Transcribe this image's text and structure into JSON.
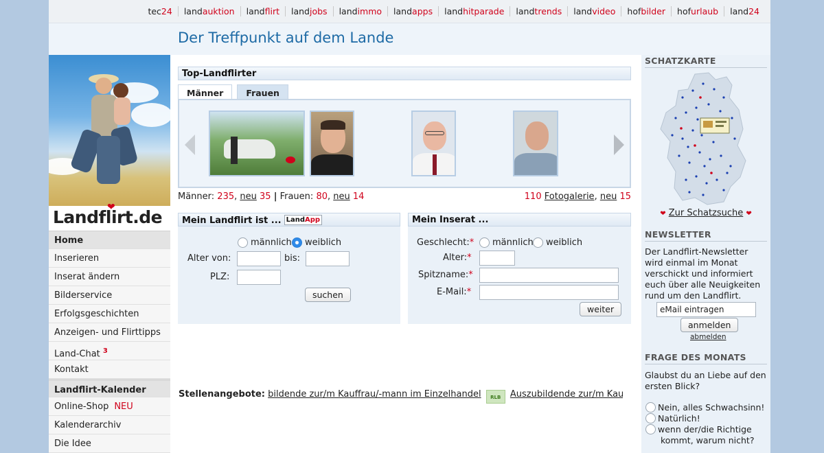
{
  "topnav": [
    {
      "a": "tec",
      "b": "24"
    },
    {
      "a": "land",
      "b": "auktion"
    },
    {
      "a": "land",
      "b": "flirt"
    },
    {
      "a": "land",
      "b": "jobs"
    },
    {
      "a": "land",
      "b": "immo"
    },
    {
      "a": "land",
      "b": "apps"
    },
    {
      "a": "land",
      "b": "hitparade"
    },
    {
      "a": "land",
      "b": "trends"
    },
    {
      "a": "land",
      "b": "video"
    },
    {
      "a": "hof",
      "b": "bilder"
    },
    {
      "a": "hof",
      "b": "urlaub"
    },
    {
      "a": "land",
      "b": "24"
    }
  ],
  "header": {
    "title": "Der Treffpunkt auf dem Lande"
  },
  "logo": {
    "text": "Landflirt.de"
  },
  "menu": {
    "home": "Home",
    "inserieren": "Inserieren",
    "inserat_aendern": "Inserat ändern",
    "bilderservice": "Bilderservice",
    "erfolgsgeschichten": "Erfolgsgeschichten",
    "anzeigen_tipps": "Anzeigen- und Flirttipps",
    "land_chat": "Land-Chat",
    "land_chat_count": "3",
    "kontakt": "Kontakt",
    "kalender_head": "Landflirt-Kalender",
    "online_shop": "Online-Shop",
    "online_shop_badge": "NEU",
    "kalenderarchiv": "Kalenderarchiv",
    "die_idee": "Die Idee"
  },
  "top": {
    "heading": "Top-Landflirter",
    "tab_maenner": "Männer",
    "tab_frauen": "Frauen"
  },
  "stats": {
    "maenner_label": "Männer:",
    "maenner_count": "235",
    "neu_label": "neu",
    "maenner_neu": "35",
    "sep": "|",
    "frauen_label": "Frauen:",
    "frauen_count": "80",
    "frauen_neu": "14",
    "foto_count": "110",
    "foto_label": "Fotogalerie",
    "foto_neu": "15"
  },
  "search": {
    "heading": "Mein Landflirt ist ...",
    "landapp_a": "Land",
    "landapp_b": "App",
    "maennlich": "männlich",
    "weiblich": "weiblich",
    "selected": "weiblich",
    "alter_von": "Alter von:",
    "bis": "bis:",
    "plz": "PLZ:",
    "button": "suchen"
  },
  "inserat": {
    "heading": "Mein Inserat ...",
    "geschlecht": "Geschlecht:",
    "maennlich": "männlich",
    "weiblich": "weiblich",
    "alter": "Alter:",
    "spitzname": "Spitzname:",
    "email": "E-Mail:",
    "req": "*",
    "button": "weiter"
  },
  "jobs": {
    "label": "Stellenangebote:",
    "job1": "bildende zur/m Kauffrau/-mann im Einzelhandel",
    "logo": "RLB",
    "job2": "Auszubildende zur/m Kauffrau/-m"
  },
  "schatzkarte": {
    "heading": "SCHATZKARTE",
    "link": "Zur Schatzsuche"
  },
  "newsletter": {
    "heading": "NEWSLETTER",
    "text": "Der Landflirt-Newsletter wird einmal im Monat verschickt und informiert euch über alle Neuigkeiten rund um den Landflirt.",
    "input_value": "eMail eintragen",
    "anmelden": "anmelden",
    "abmelden": "abmelden"
  },
  "frage": {
    "heading": "FRAGE DES MONATS",
    "question": "Glaubst du an Liebe auf den ersten Blick?",
    "opt1": "Nein, alles Schwachsinn!",
    "opt2": "Natürlich!",
    "opt3a": "wenn der/die Richtige",
    "opt3b": "kommt, warum nicht?"
  },
  "colors": {
    "accent_red": "#d0021b",
    "title_blue": "#1d6aa5",
    "page_bg": "#b3c9e1"
  }
}
